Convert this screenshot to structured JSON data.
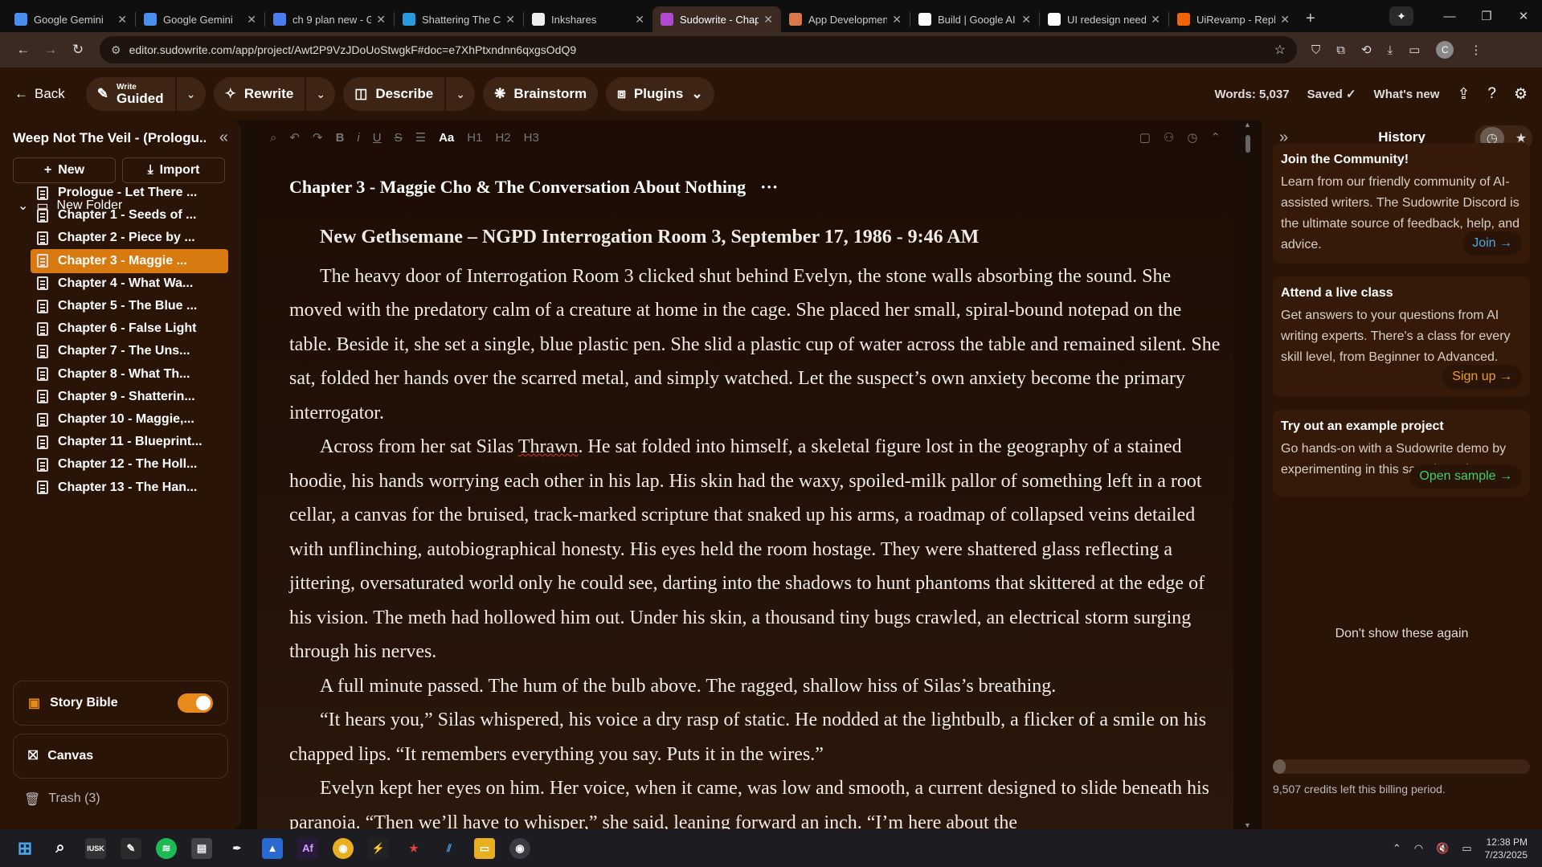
{
  "browser": {
    "tabs": [
      {
        "title": "Google Gemini",
        "icon": "gemini-icon",
        "color": "#4a8ef0"
      },
      {
        "title": "Google Gemini",
        "icon": "gemini-icon",
        "color": "#4a8ef0"
      },
      {
        "title": "ch 9 plan new - G",
        "icon": "docs-icon",
        "color": "#4a7ef0"
      },
      {
        "title": "Shattering The Cl",
        "icon": "app-icon",
        "color": "#2a9ae0"
      },
      {
        "title": "Inkshares",
        "icon": "inkshares-icon",
        "color": "#eeeeee"
      },
      {
        "title": "Sudowrite - Chap",
        "icon": "sudowrite-icon",
        "color": "#b04ad0"
      },
      {
        "title": "App Developmen",
        "icon": "claude-icon",
        "color": "#d9774a"
      },
      {
        "title": "Build | Google AI",
        "icon": "build-icon",
        "color": "#ffffff"
      },
      {
        "title": "UI redesign need",
        "icon": "ui-icon",
        "color": "#ffffff"
      },
      {
        "title": "UiRevamp - Repl",
        "icon": "replit-icon",
        "color": "#f26207"
      }
    ],
    "active_tab": 5,
    "url": "editor.sudowrite.com/app/project/Awt2P9VzJDoUoStwgkF#doc=e7XhPtxndnn6qxgsOdQ9"
  },
  "toolbar": {
    "back": "Back",
    "write_small": "Write",
    "write_big": "Guided",
    "rewrite": "Rewrite",
    "describe": "Describe",
    "brainstorm": "Brainstorm",
    "plugins": "Plugins",
    "words": "Words: 5,037",
    "saved": "Saved",
    "whats_new": "What's new"
  },
  "sidebar": {
    "project_title": "Weep Not The Veil - (Prologu...",
    "new_label": "New",
    "import_label": "Import",
    "folder": "New Folder",
    "chapters": [
      "Prologue - Let There ...",
      "Chapter 1 - Seeds of ...",
      "Chapter 2 - Piece by ...",
      "Chapter 3 - Maggie ...",
      "Chapter 4 - What Wa...",
      "Chapter 5 - The Blue ...",
      "Chapter 6 - False Light",
      "Chapter 7 - The Uns...",
      "Chapter 8 - What Th...",
      "Chapter 9 - Shatterin...",
      "Chapter 10 - Maggie,...",
      "Chapter 11 - Blueprint...",
      "Chapter 12 - The Holl...",
      "Chapter 13 - The Han..."
    ],
    "active_chapter": 3,
    "story_bible": "Story Bible",
    "story_bible_on": true,
    "canvas": "Canvas",
    "trash": "Trash (3)"
  },
  "editor": {
    "format_tools": [
      "search",
      "undo",
      "redo",
      "B",
      "i",
      "U",
      "S",
      "list",
      "Aa",
      "H1",
      "H2",
      "H3"
    ],
    "chapter_title": "Chapter 3 - Maggie Cho & The Conversation About Nothing",
    "scene_heading": "New Gethsemane – NGPD Interrogation Room 3, September 17, 1986 - 9:46 AM",
    "p1": "The heavy door of Interrogation Room 3 clicked shut behind Evelyn, the stone walls absorbing the sound. She moved with the predatory calm of a creature at home in the cage. She placed her small, spiral-bound notepad on the table. Beside it, she set a single, blue plastic pen. She slid a plastic cup of water across the table and remained silent. She sat, folded her hands over the scarred metal, and simply watched. Let the suspect’s own anxiety become the primary interrogator.",
    "p2a": "Across from her sat Silas ",
    "p2_name": "Thrawn",
    "p2b": ". He sat folded into himself, a skeletal figure lost in the geography of a stained hoodie, his hands worrying each other in his lap. His skin had the waxy, spoiled-milk pallor of something left in a root cellar, a canvas for the bruised, track-marked scripture that snaked up his arms, a roadmap of collapsed veins detailed with unflinching, autobiographical honesty. His eyes held the room hostage. They were shattered glass reflecting a jittering, oversaturated world only he could see, darting into the shadows to hunt phantoms that skittered at the edge of his vision. The meth had hollowed him out. Under his skin, a thousand tiny bugs crawled, an electrical storm surging through his nerves.",
    "p3": "A full minute passed. The hum of the bulb above. The ragged, shallow hiss of Silas’s breathing.",
    "p4": "“It hears you,” Silas whispered, his voice a dry rasp of static. He nodded at the lightbulb, a flicker of a smile on his chapped lips. “It remembers everything you say. Puts it in the wires.”",
    "p5": "Evelyn kept her eyes on him. Her voice, when it came, was low and smooth, a current designed to slide beneath his paranoia. “Then we’ll have to whisper,” she said, leaning forward an inch. “I’m here about the"
  },
  "history": {
    "title": "History",
    "cards": [
      {
        "title": "Join the Community!",
        "body": "Learn from our friendly community of AI-assisted writers. The Sudowrite Discord is the ultimate source of feedback, help, and advice.",
        "cta": "Join →",
        "cta_color": "#4aa8e8"
      },
      {
        "title": "Attend a live class",
        "body": "Get answers to your questions from AI writing experts. There's a class for every skill level, from Beginner to Advanced.",
        "cta": "Sign up →",
        "cta_color": "#e8a030"
      },
      {
        "title": "Try out an example project",
        "body": "Go hands-on with a Sudowrite demo by experimenting in this sample project.",
        "cta": "Open sample →",
        "cta_color": "#3ecf6a"
      }
    ],
    "dont_show": "Don't show these again",
    "credits": "9,507 credits left this billing period.",
    "credits_used_fraction": 0.05
  },
  "taskbar": {
    "time": "12:38 PM",
    "date": "7/23/2025"
  },
  "colors": {
    "accent": "#d97a10",
    "bg": "#2a1408"
  }
}
